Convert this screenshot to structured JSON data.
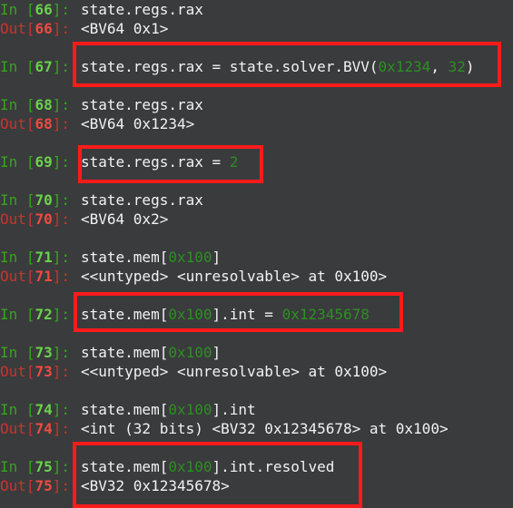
{
  "cells": [
    {
      "n": "66",
      "input": [
        "state.regs.rax"
      ],
      "output": "<BV64 0x1>"
    },
    {
      "n": "67",
      "input": [
        "state.regs.rax = state.solver.BVV(",
        {
          "lit": "0x1234"
        },
        ", ",
        {
          "lit": "32"
        },
        ")"
      ],
      "highlighted": true
    },
    {
      "n": "68",
      "input": [
        "state.regs.rax"
      ],
      "output": "<BV64 0x1234>"
    },
    {
      "n": "69",
      "input": [
        "state.regs.rax = ",
        {
          "lit": "2"
        }
      ],
      "highlighted": true
    },
    {
      "n": "70",
      "input": [
        "state.regs.rax"
      ],
      "output": "<BV64 0x2>"
    },
    {
      "n": "71",
      "input": [
        "state.mem[",
        {
          "lit": "0x100"
        },
        "]"
      ],
      "output": "<<untyped> <unresolvable> at 0x100>"
    },
    {
      "n": "72",
      "input": [
        "state.mem[",
        {
          "lit": "0x100"
        },
        "].int = ",
        {
          "lit": "0x12345678"
        }
      ],
      "highlighted": true
    },
    {
      "n": "73",
      "input": [
        "state.mem[",
        {
          "lit": "0x100"
        },
        "]"
      ],
      "output": "<<untyped> <unresolvable> at 0x100>"
    },
    {
      "n": "74",
      "input": [
        "state.mem[",
        {
          "lit": "0x100"
        },
        "].int"
      ],
      "output": "<int (32 bits) <BV32 0x12345678> at 0x100>"
    },
    {
      "n": "75",
      "input": [
        "state.mem[",
        {
          "lit": "0x100"
        },
        "].int.resolved"
      ],
      "output": "<BV32 0x12345678>",
      "highlighted": true
    }
  ],
  "colors": {
    "background": "#3a3b3d",
    "in_prompt": "#35a51c",
    "out_prompt": "#c8342d",
    "literal": "#2d8f22",
    "highlight_box": "#ff1b1b"
  }
}
